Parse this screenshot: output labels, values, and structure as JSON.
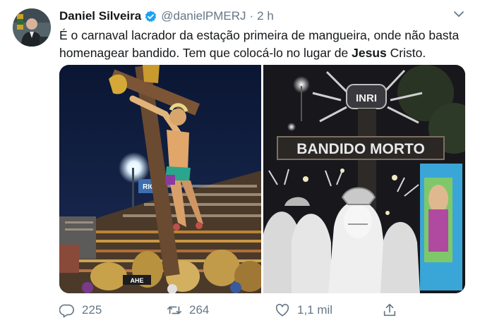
{
  "tweet": {
    "author": {
      "display_name": "Daniel Silveira",
      "handle": "@danielPMERJ",
      "verified_icon": "verified-badge-icon",
      "avatar": "avatar"
    },
    "separator": "·",
    "timestamp": "2 h",
    "text_part1": "É o carnaval lacrador da estação primeira de mangueira, onde não basta homenagear bandido. Tem que colocá-lo no lugar de ",
    "text_bold": "Jesus",
    "text_part2": " Cristo.",
    "media": {
      "left_photo_sign": "RIO",
      "right_photo_top_sign": "INRI",
      "right_photo_sign": "BANDIDO MORTO",
      "banner_text": "AHE"
    },
    "actions": {
      "replies": "225",
      "retweets": "264",
      "likes": "1,1 mil"
    }
  },
  "colors": {
    "text": "#14171a",
    "secondary": "#657786",
    "verified": "#1da1f2"
  }
}
